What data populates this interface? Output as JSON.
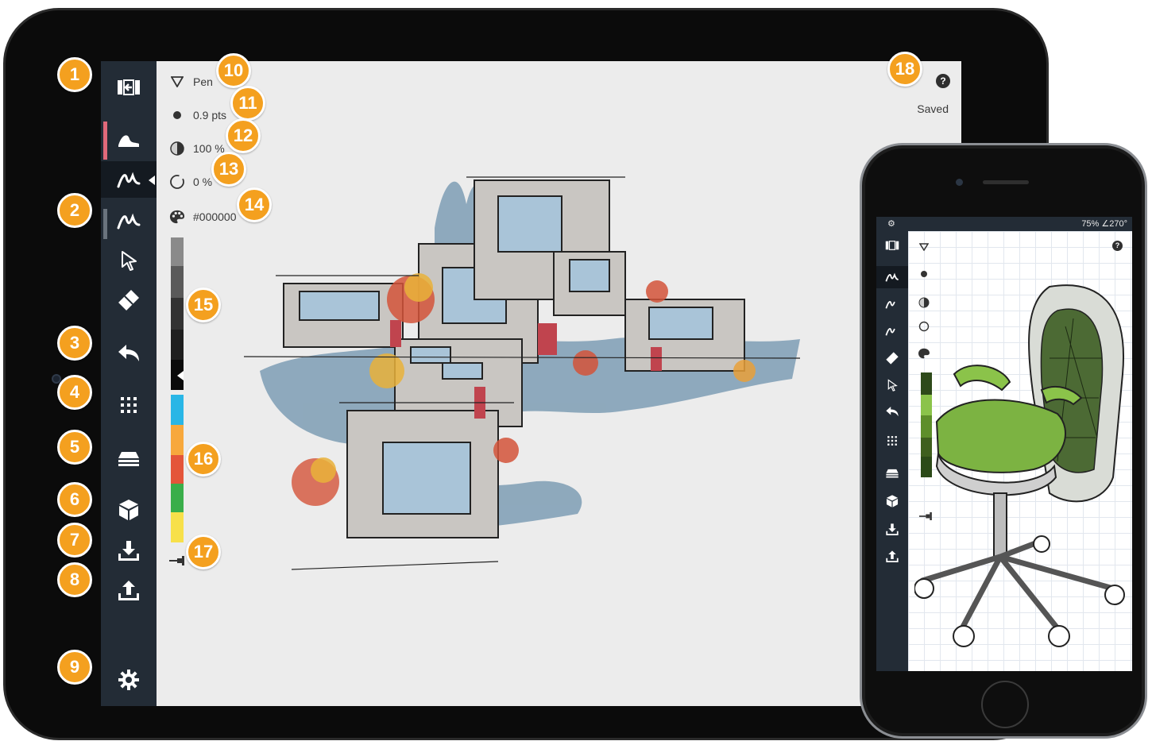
{
  "tablet": {
    "properties": {
      "tool": "Pen",
      "size": "0.9 pts",
      "opacity": "100 %",
      "smoothing": "0 %",
      "color": "#000000"
    },
    "status": "Saved",
    "help": "?"
  },
  "phone": {
    "status_left": "⚙",
    "status_right": "75% ∠270°",
    "help": "?"
  },
  "callouts": [
    "1",
    "2",
    "3",
    "4",
    "5",
    "6",
    "7",
    "8",
    "9",
    "10",
    "11",
    "12",
    "13",
    "14",
    "15",
    "16",
    "17",
    "18"
  ],
  "palette": {
    "greys": [
      "#8a8a8a",
      "#5a5a5a",
      "#333333",
      "#1f1f1f",
      "#0a0a0a"
    ],
    "colors": [
      "#29b6e6",
      "#f7a83c",
      "#e4553a",
      "#3aae4a",
      "#f7e04a"
    ],
    "phone_greens": [
      "#2e4a1a",
      "#8bc34a",
      "#5e8e2a",
      "#3f5f1e",
      "#2c4a18"
    ]
  },
  "colors": {
    "badge": "#f4a01f",
    "sidebar": "#232c36",
    "active_marker": "#e0697a"
  }
}
